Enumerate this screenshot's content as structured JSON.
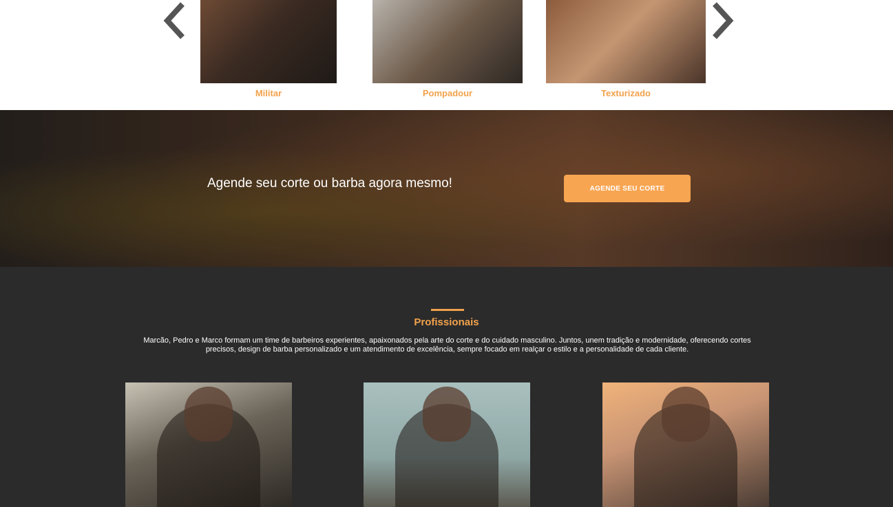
{
  "carousel": {
    "prev_icon": "chevron-left-icon",
    "next_icon": "chevron-right-icon",
    "slides": [
      {
        "caption": "Militar"
      },
      {
        "caption": "Pompadour"
      },
      {
        "caption": "Texturizado"
      }
    ]
  },
  "cta": {
    "text": "Agende seu corte ou barba agora mesmo!",
    "button_label": "AGENDE SEU CORTE"
  },
  "professionals": {
    "title": "Profissionais",
    "description": "Marcão, Pedro e Marco formam um time de barbeiros experientes, apaixonados pela arte do corte e do cuidado masculino. Juntos, unem tradição e modernidade, oferecendo cortes precisos, design de barba personalizado e um atendimento de excelência, sempre focado em realçar o estilo e a personalidade de cada cliente."
  },
  "colors": {
    "accent": "#f2a24c",
    "button": "#f8a552",
    "dark_bg": "#2b2b2b",
    "white": "#ffffff"
  }
}
